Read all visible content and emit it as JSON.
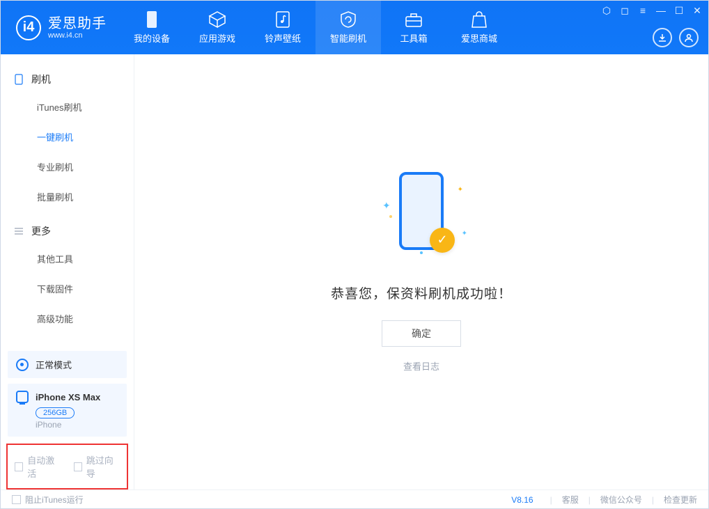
{
  "app": {
    "title": "爱思助手",
    "subtitle": "www.i4.cn"
  },
  "nav": {
    "tabs": [
      {
        "label": "我的设备"
      },
      {
        "label": "应用游戏"
      },
      {
        "label": "铃声壁纸"
      },
      {
        "label": "智能刷机"
      },
      {
        "label": "工具箱"
      },
      {
        "label": "爱思商城"
      }
    ]
  },
  "sidebar": {
    "section1": {
      "title": "刷机",
      "items": [
        "iTunes刷机",
        "一键刷机",
        "专业刷机",
        "批量刷机"
      ]
    },
    "section2": {
      "title": "更多",
      "items": [
        "其他工具",
        "下载固件",
        "高级功能"
      ]
    },
    "mode_label": "正常模式",
    "device": {
      "name": "iPhone XS Max",
      "storage": "256GB",
      "type": "iPhone"
    },
    "options": {
      "auto_activate": "自动激活",
      "skip_guide": "跳过向导"
    }
  },
  "main": {
    "success_text": "恭喜您，保资料刷机成功啦！",
    "ok_button": "确定",
    "view_log": "查看日志"
  },
  "footer": {
    "block_itunes": "阻止iTunes运行",
    "version": "V8.16",
    "links": [
      "客服",
      "微信公众号",
      "检查更新"
    ]
  }
}
